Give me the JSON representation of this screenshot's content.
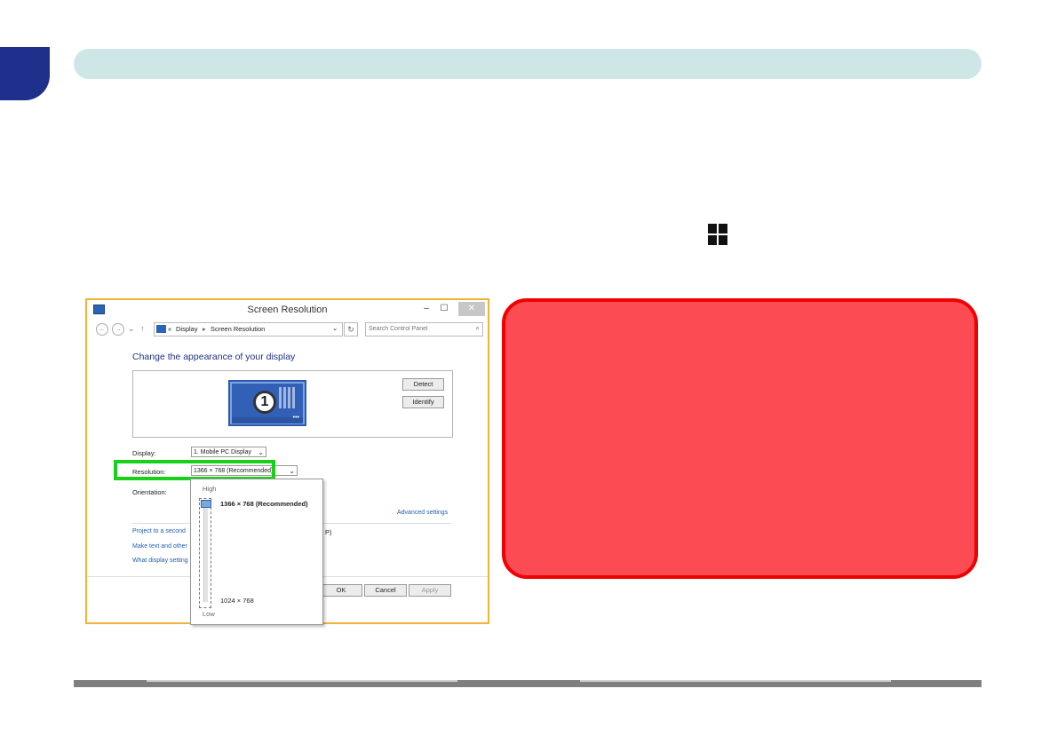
{
  "colors": {
    "chapter_tab": "#1f2f8c",
    "header_bar": "#cfe6e6",
    "notice_fill": "#fc4b52",
    "notice_border": "#f00000",
    "highlight": "#18d018"
  },
  "dialog": {
    "title": "Screen Resolution",
    "window_controls": {
      "minimize": "–",
      "maximize": "☐",
      "close": "✕"
    },
    "nav": {
      "back": "←",
      "forward": "→",
      "recent": "⌄",
      "up": "↑",
      "chevrons": "«"
    },
    "breadcrumb": [
      "Display",
      "Screen Resolution"
    ],
    "breadcrumb_sep": "▸",
    "refresh": "↻",
    "search_placeholder": "Search Control Panel",
    "search_icon": "⌕",
    "heading": "Change the appearance of your display",
    "monitor_number": "1",
    "monitor_dots": "•••",
    "detect_button": "Detect",
    "identify_button": "Identify",
    "display_label": "Display:",
    "display_value": "1. Mobile PC Display",
    "resolution_label": "Resolution:",
    "resolution_value": "1366 × 768 (Recommended)",
    "orientation_label": "Orientation:",
    "advanced_link": "Advanced settings",
    "links": [
      "Project to a second",
      "Make text and other",
      "What display setting"
    ],
    "project_suffix": "P)",
    "ok_button": "OK",
    "cancel_button": "Cancel",
    "apply_button": "Apply",
    "dropdown_arrow": "⌄"
  },
  "resolution_dropdown": {
    "high_label": "High",
    "low_label": "Low",
    "top_option": "1366 × 768 (Recommended)",
    "bottom_option": "1024 × 768",
    "slider_level": 1.0
  }
}
